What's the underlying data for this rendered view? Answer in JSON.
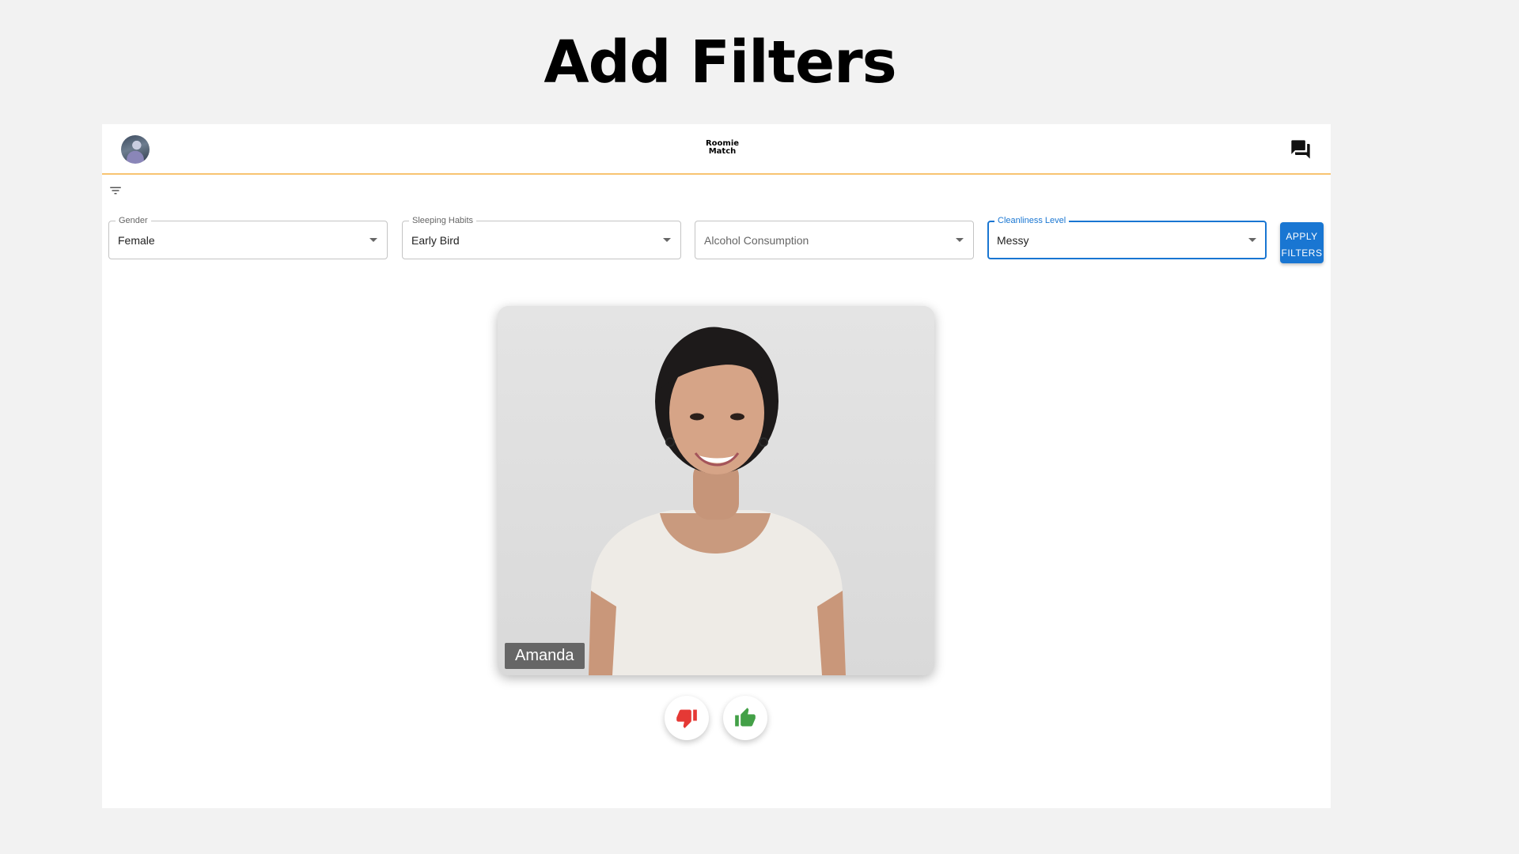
{
  "slide": {
    "title": "Add Filters"
  },
  "app": {
    "brand_line1": "Roomie",
    "brand_line2": "Match"
  },
  "filters": {
    "gender": {
      "label": "Gender",
      "value": "Female"
    },
    "sleeping": {
      "label": "Sleeping Habits",
      "value": "Early Bird"
    },
    "alcohol": {
      "label": "",
      "placeholder": "Alcohol Consumption"
    },
    "cleanliness": {
      "label": "Cleanliness Level",
      "value": "Messy"
    },
    "apply_line1": "APPLY",
    "apply_line2": "FILTERS"
  },
  "profile": {
    "name": "Amanda"
  },
  "colors": {
    "accent": "#1976d2",
    "header_border": "#f8c471",
    "dislike": "#e53935",
    "like": "#43a047"
  },
  "icons": {
    "avatar": "user-avatar",
    "chat": "forum-icon",
    "filter": "filter-list-icon",
    "dislike": "thumb-down-icon",
    "like": "thumb-up-icon"
  }
}
